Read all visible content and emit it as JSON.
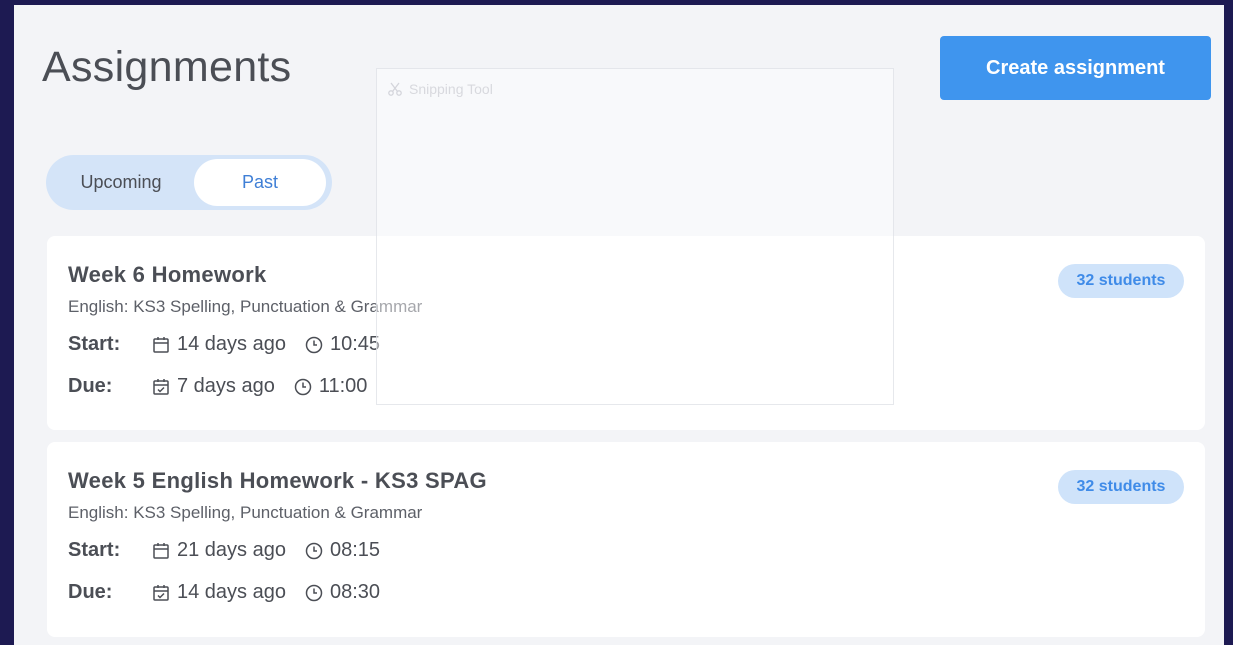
{
  "page": {
    "title": "Assignments",
    "create_label": "Create assignment"
  },
  "tabs": [
    {
      "label": "Upcoming",
      "active": false
    },
    {
      "label": "Past",
      "active": true
    }
  ],
  "labels": {
    "start": "Start:",
    "due": "Due:"
  },
  "assignments": [
    {
      "title": "Week 6 Homework",
      "subject": "English: KS3 Spelling, Punctuation & Grammar",
      "students": "32 students",
      "start_date": "14 days ago",
      "start_time": "10:45",
      "due_date": "7 days ago",
      "due_time": "11:00"
    },
    {
      "title": "Week 5 English Homework - KS3 SPAG",
      "subject": "English: KS3 Spelling, Punctuation & Grammar",
      "students": "32 students",
      "start_date": "21 days ago",
      "start_time": "08:15",
      "due_date": "14 days ago",
      "due_time": "08:30"
    }
  ],
  "overlay": {
    "title": "Snipping Tool"
  },
  "colors": {
    "accent": "#3f95ee",
    "background": "#1d1a52",
    "badge_bg": "#cfe3fa",
    "badge_text": "#3f8be8"
  },
  "icons": [
    "calendar-icon",
    "calendar-check-icon",
    "clock-icon",
    "scissors-icon"
  ]
}
